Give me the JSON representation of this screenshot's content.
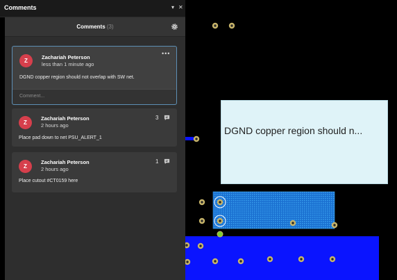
{
  "panel": {
    "window_title": "Comments",
    "pin_glyph": "▾",
    "close_glyph": "✕",
    "header_title": "Comments",
    "header_count": "(3)",
    "settings_icon": "gear-icon"
  },
  "comments": [
    {
      "initial": "Z",
      "author": "Zachariah Peterson",
      "time": "less than 1 minute ago",
      "text": "DGND copper region should not overlap with SW net.",
      "menu": "•••",
      "input_placeholder": "Comment..."
    },
    {
      "initial": "Z",
      "author": "Zachariah Peterson",
      "time": "2 hours ago",
      "text": "Place pad down to net PSU_ALERT_1",
      "replies": "3"
    },
    {
      "initial": "Z",
      "author": "Zachariah Peterson",
      "time": "2 hours ago",
      "text": "Place cutout #CT0159 here",
      "replies": "1"
    }
  ],
  "canvas": {
    "tooltip_text": "DGND copper region should n...",
    "colors": {
      "background": "#000000",
      "copper_blue": "#0a14ff",
      "hatched_region": "#1e7fd4",
      "tooltip_bg": "#dff3f8",
      "pad_olive": "#c8b56a",
      "selected_pad": "#7ecf2e",
      "avatar_red": "#d63f4c"
    }
  }
}
